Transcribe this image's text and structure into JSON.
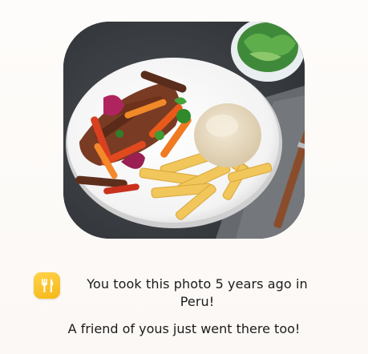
{
  "memory": {
    "photo_alt": "Plate of lomo saltado with fries and rice",
    "app_icon": "fork-knife-icon",
    "message": "You took this photo 5 years ago in Peru!",
    "sub_message": "A friend of yous just went there too!"
  },
  "colors": {
    "icon_yellow": "#f8c52a",
    "text": "#1b1b1b",
    "background": "#fdfbf9"
  }
}
